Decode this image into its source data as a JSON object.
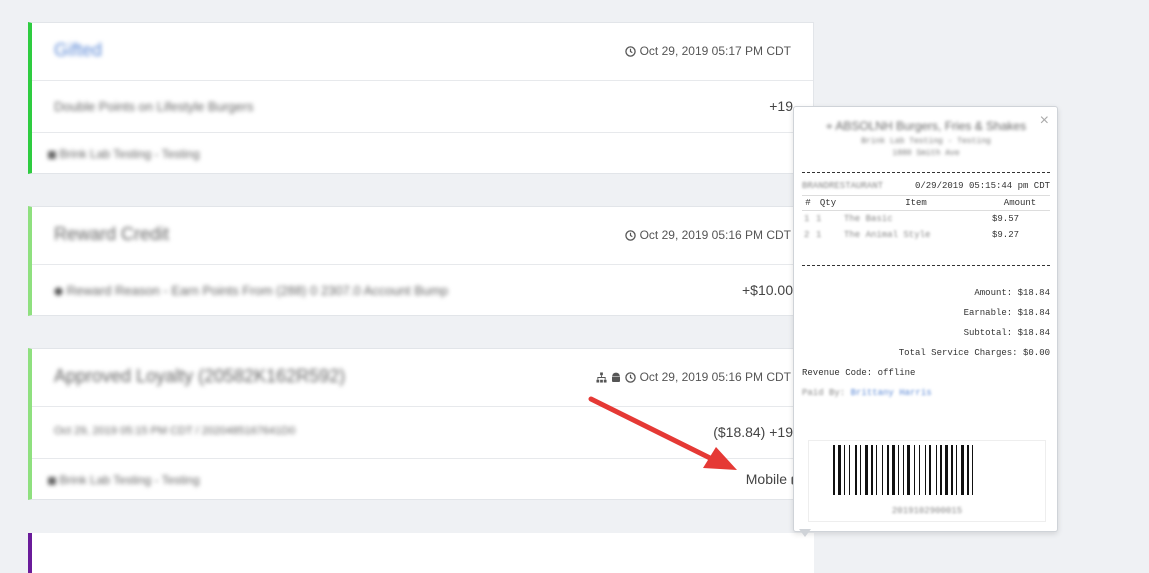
{
  "cards": [
    {
      "title": "Gifted",
      "date": "Oct 29, 2019 05:17 PM CDT",
      "subtitle": "Double Points on Lifestyle Burgers",
      "amount": "+19",
      "location": "Brink Lab Testing - Testing",
      "border_color": "#2ecc40"
    },
    {
      "title": "Reward Credit",
      "date": "Oct 29, 2019 05:16 PM CDT",
      "subtitle": "Reward Reason - Earn Points From (288) 0 2307.0 Account Bump",
      "amount": "+$10.00",
      "border_color": "#8fe07f"
    },
    {
      "title": "Approved Loyalty (20582K162R592)",
      "date": "Oct 29, 2019 05:16 PM CDT",
      "subtitle": "Oct 29, 2019 05:15 PM CDT / 2020485167641D0",
      "amount": "($18.84) +19",
      "location": "Brink Lab Testing - Testing",
      "channel": "Mobile",
      "border_color": "#8fe07f"
    }
  ],
  "receipt": {
    "store": "ABSOLNH Burgers, Fries & Shakes",
    "store_line1": "Brink Lab Testing - Testing",
    "store_line2": "1880 Smith Ave",
    "order_ref": "BRANDRESTAURANT",
    "datetime": "0/29/2019 05:15:44 pm CDT",
    "columns": [
      "#",
      "Qty",
      "Item",
      "Amount"
    ],
    "items": [
      {
        "num": "1",
        "qty": "1",
        "name": "The Basic",
        "amount": "$9.57"
      },
      {
        "num": "2",
        "qty": "1",
        "name": "The Animal Style",
        "amount": "$9.27"
      }
    ],
    "amount_line": "Amount: $18.84",
    "earnable_line": "Earnable: $18.84",
    "subtotal_line": "Subtotal: $18.84",
    "service_line": "Total Service Charges: $0.00",
    "revenue_line": "Revenue Code: offline",
    "paid_by_label": "Paid By:",
    "paid_by": "Brittany Harris",
    "barcode_number": "2019102900015"
  },
  "colors": {
    "accent_green": "#2ecc40",
    "link_blue": "#5d8ad6",
    "arrow_red": "#e53935",
    "purple": "#6a1b9a"
  },
  "icons": [
    "clock-icon",
    "sitemap-icon",
    "android-icon",
    "camera-icon",
    "close-icon",
    "map-marker-icon",
    "exchange-icon"
  ]
}
